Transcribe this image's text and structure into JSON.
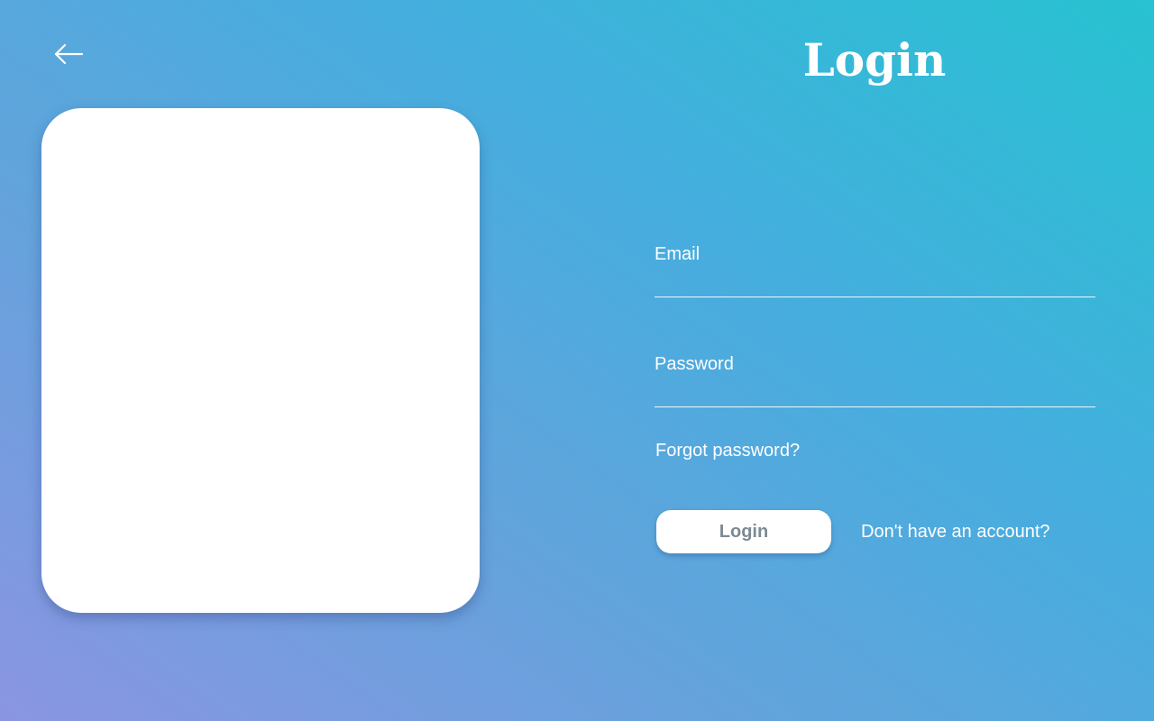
{
  "header": {
    "title": "Login",
    "back_icon": "arrow-left-icon"
  },
  "form": {
    "email": {
      "label": "Email",
      "value": "",
      "placeholder": ""
    },
    "password": {
      "label": "Password",
      "value": "",
      "placeholder": ""
    },
    "forgot_password": "Forgot password?",
    "login_label": "Login",
    "signup_prompt": "Don't have an account?"
  },
  "colors": {
    "gradient_start": "#27c2d1",
    "gradient_end": "#8b95e2",
    "button_text": "#7c8a93"
  }
}
